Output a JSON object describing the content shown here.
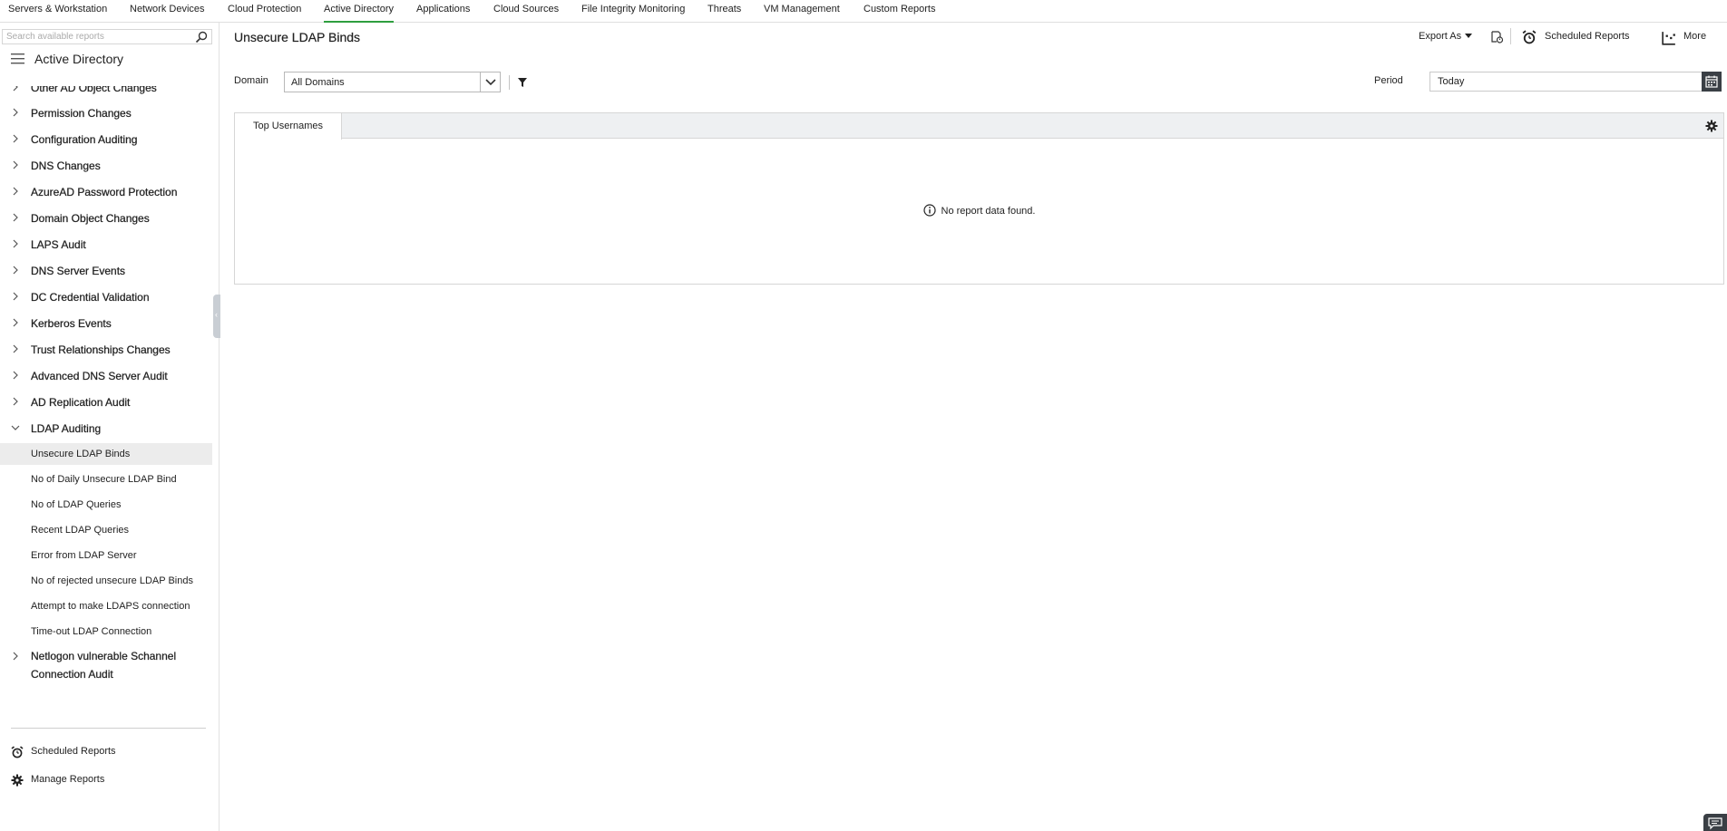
{
  "topnav": {
    "tabs": [
      {
        "label": "Servers & Workstation"
      },
      {
        "label": "Network Devices"
      },
      {
        "label": "Cloud Protection"
      },
      {
        "label": "Active Directory"
      },
      {
        "label": "Applications"
      },
      {
        "label": "Cloud Sources"
      },
      {
        "label": "File Integrity Monitoring"
      },
      {
        "label": "Threats"
      },
      {
        "label": "VM Management"
      },
      {
        "label": "Custom Reports"
      }
    ],
    "active_tab": "Active Directory"
  },
  "sidebar": {
    "search_placeholder": "Search available reports",
    "title": "Active Directory",
    "groups": [
      {
        "label": "Other AD Object Changes"
      },
      {
        "label": "Permission Changes"
      },
      {
        "label": "Configuration Auditing"
      },
      {
        "label": "DNS Changes"
      },
      {
        "label": "AzureAD Password Protection"
      },
      {
        "label": "Domain Object Changes"
      },
      {
        "label": "LAPS Audit"
      },
      {
        "label": "DNS Server Events"
      },
      {
        "label": "DC Credential Validation"
      },
      {
        "label": "Kerberos Events"
      },
      {
        "label": "Trust Relationships Changes"
      },
      {
        "label": "Advanced DNS Server Audit"
      },
      {
        "label": "AD Replication Audit"
      },
      {
        "label": "LDAP Auditing"
      }
    ],
    "ldap_reports": [
      {
        "label": "Unsecure LDAP Binds"
      },
      {
        "label": "No of Daily Unsecure LDAP Bind"
      },
      {
        "label": "No of LDAP Queries"
      },
      {
        "label": "Recent LDAP Queries"
      },
      {
        "label": "Error from LDAP Server"
      },
      {
        "label": "No of rejected unsecure LDAP Binds"
      },
      {
        "label": "Attempt to make LDAPS connection"
      },
      {
        "label": "Time-out LDAP Connection"
      }
    ],
    "selected_report": "Unsecure LDAP Binds",
    "last_group_line1": "Netlogon vulnerable Schannel",
    "last_group_line2": "Connection Audit",
    "bottom": {
      "scheduled_reports": "Scheduled Reports",
      "manage_reports": "Manage Reports"
    }
  },
  "main": {
    "title": "Unsecure LDAP Binds",
    "toolbar": {
      "export_label": "Export As",
      "scheduled_reports_label": "Scheduled Reports",
      "more_label": "More"
    },
    "filters": {
      "domain_label": "Domain",
      "domain_value": "All Domains",
      "period_label": "Period",
      "period_value": "Today"
    },
    "panel": {
      "tab_label": "Top Usernames",
      "empty_message": "No report data found."
    }
  },
  "colors": {
    "active_tab_underline": "#2e9e3f",
    "selected_item_bg": "#ececec",
    "calendar_button": "#3a3f45"
  }
}
